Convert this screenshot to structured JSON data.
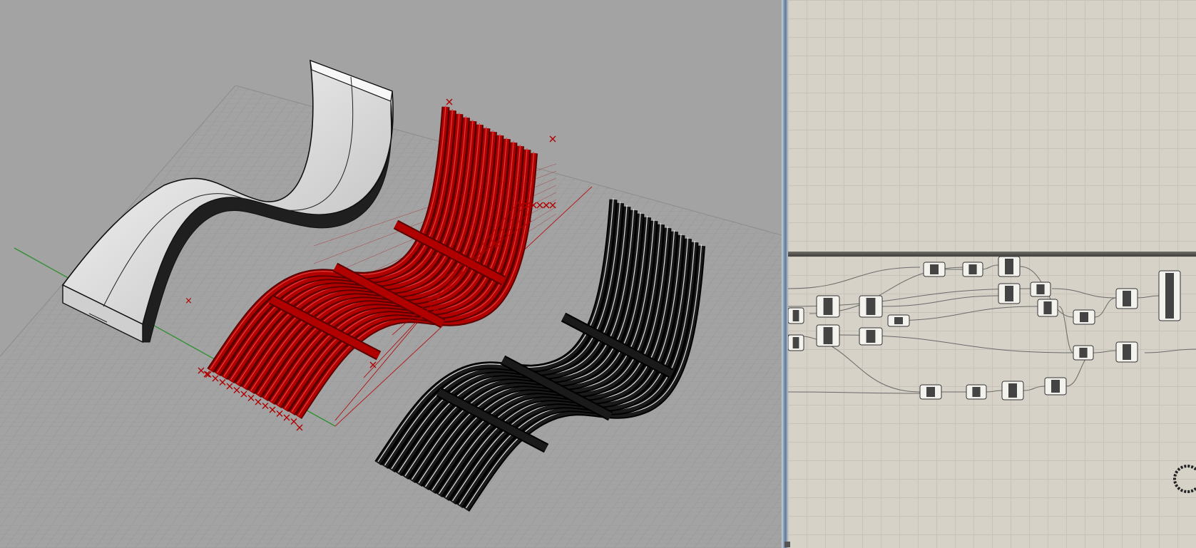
{
  "viewport": {
    "background": "#a3a3a3",
    "grid_color": "#8e8e8e",
    "x_axis_color": "#b02020",
    "y_axis_color": "#2f8f2f",
    "models": [
      {
        "name": "solid-surface",
        "fill": "#f2f2f2"
      },
      {
        "name": "slat-preview",
        "fill": "#b00000",
        "slats": 14
      },
      {
        "name": "slat-render",
        "fill": "#1a1a1a",
        "slats": 14
      }
    ]
  },
  "canvas": {
    "background": "#d6d2c8",
    "grid_color": "#c7c3b8",
    "component_fill": "#f4f2ed",
    "component_dark": "#444444",
    "wire_color": "#6a6a6a",
    "widget": "zoom-dial-icon"
  }
}
